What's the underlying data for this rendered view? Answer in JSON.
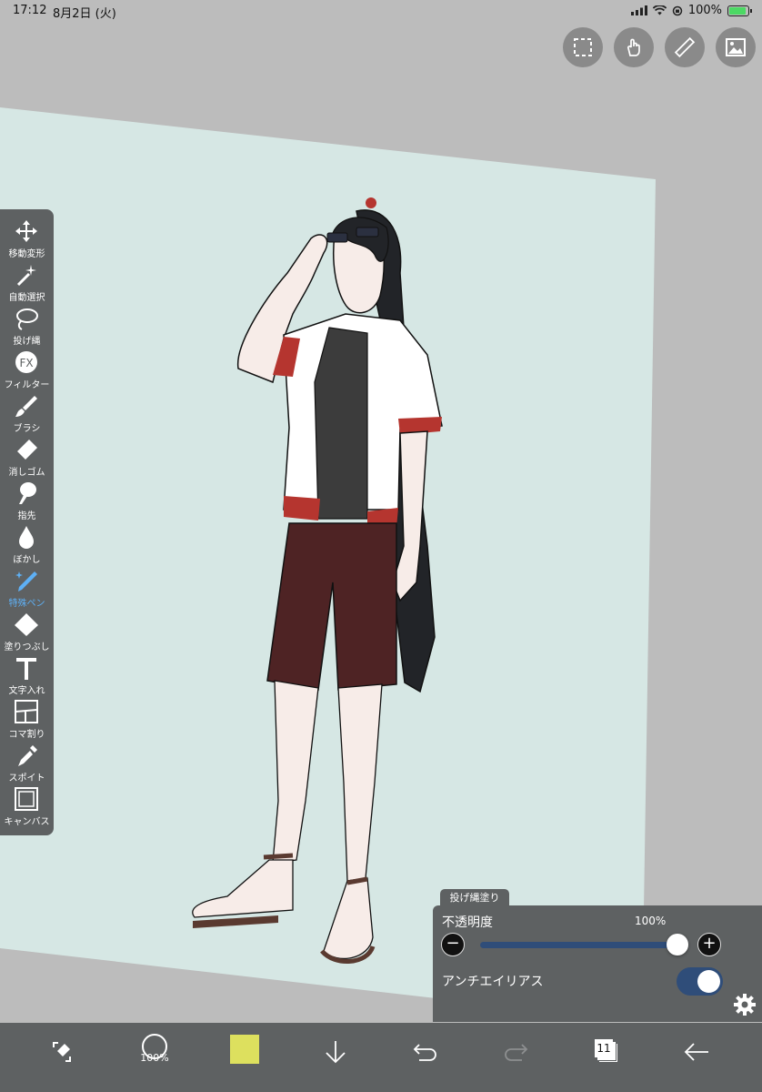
{
  "status_bar": {
    "time": "17:12",
    "date": "8月2日 (火)",
    "battery": "100%"
  },
  "top_actions": [
    {
      "name": "selection-icon"
    },
    {
      "name": "gesture-hand-icon"
    },
    {
      "name": "ruler-icon"
    },
    {
      "name": "reference-image-icon"
    }
  ],
  "tools": [
    {
      "label": "移動変形",
      "icon": "move-transform-icon"
    },
    {
      "label": "自動選択",
      "icon": "magic-wand-icon"
    },
    {
      "label": "投げ縄",
      "icon": "lasso-icon"
    },
    {
      "label": "フィルター",
      "icon": "fx-filter-icon"
    },
    {
      "label": "ブラシ",
      "icon": "brush-icon"
    },
    {
      "label": "消しゴム",
      "icon": "eraser-icon"
    },
    {
      "label": "指先",
      "icon": "finger-smudge-icon"
    },
    {
      "label": "ぼかし",
      "icon": "blur-drop-icon"
    },
    {
      "label": "特殊ペン",
      "icon": "special-pen-icon"
    },
    {
      "label": "塗りつぶし",
      "icon": "fill-bucket-icon"
    },
    {
      "label": "文字入れ",
      "icon": "text-icon"
    },
    {
      "label": "コマ割り",
      "icon": "frame-divider-icon"
    },
    {
      "label": "スポイト",
      "icon": "eyedropper-icon"
    },
    {
      "label": "キャンバス",
      "icon": "canvas-icon"
    }
  ],
  "active_tool": "特殊ペン",
  "panel": {
    "tab": "投げ縄塗り",
    "opacity_label": "不透明度",
    "opacity_value": "100%",
    "opacity": 1.0,
    "antialias_label": "アンチエイリアス",
    "antialias_on": true
  },
  "bottom_bar": {
    "brush_size": "100%",
    "primary_color": "#dde05e",
    "layer_count": "11"
  },
  "colors": {
    "toolbar_bg": "#5e6162",
    "accent": "#2f4d79",
    "active_tool": "#5eb0f5",
    "canvas": "#d6e7e4",
    "workspace": "#bcbcbc"
  }
}
